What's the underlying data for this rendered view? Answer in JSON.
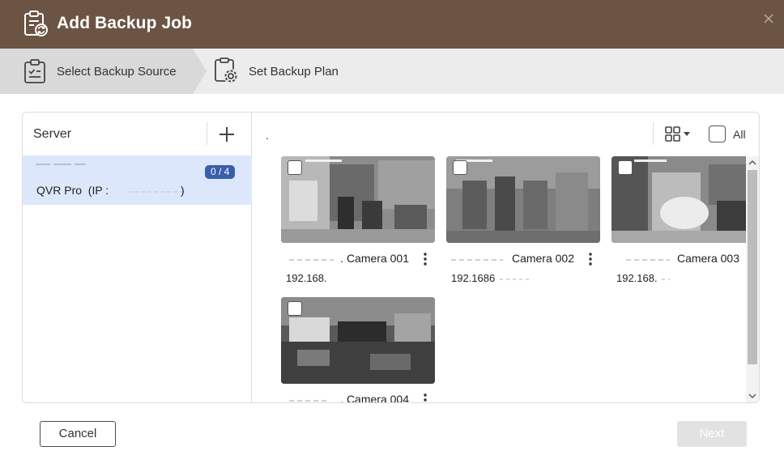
{
  "dialog": {
    "title": "Add Backup Job",
    "title_icon": "clipboard-sync-icon",
    "close_icon": "close-icon"
  },
  "steps": [
    {
      "label": "Select Backup Source",
      "icon": "checklist-clipboard-icon",
      "active": true
    },
    {
      "label": "Set Backup Plan",
      "icon": "settings-gear-icon",
      "active": false
    }
  ],
  "left_pane": {
    "header": "Server",
    "add_icon": "plus-icon",
    "servers": [
      {
        "name": "QVR Pro  (IP :",
        "ip_suffix": ")",
        "badge": "0 / 4",
        "selected": true
      }
    ]
  },
  "right_pane": {
    "path": ".",
    "view_icon": "grid-view-icon",
    "select_all_label": "All",
    "cameras": [
      {
        "name": ". Camera 001",
        "ip": "192.168.",
        "checked": false
      },
      {
        "name": "Camera 002",
        "ip": "192.1686",
        "checked": false
      },
      {
        "name": "Camera 003",
        "ip": "192.168.",
        "checked": false
      },
      {
        "name": ". Camera 004",
        "ip": "",
        "checked": false
      }
    ]
  },
  "footer": {
    "cancel_label": "Cancel",
    "next_label": "Next"
  },
  "colors": {
    "header_bg": "#6b5443",
    "selected_server_bg": "#dde7fb",
    "badge_bg": "#3a5ea8",
    "next_disabled_bg": "#e2e2e2"
  }
}
